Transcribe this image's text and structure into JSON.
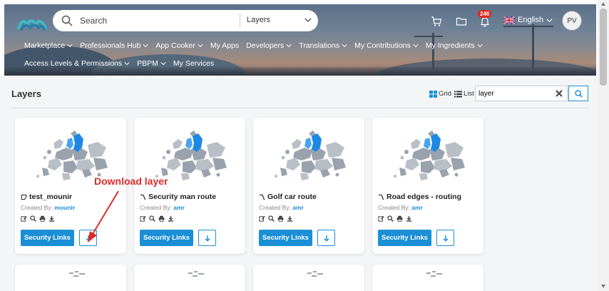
{
  "header": {
    "search_placeholder": "Search",
    "search_scope": "Layers",
    "notification_count": "246",
    "language": "English",
    "user_initials": "PV"
  },
  "nav": {
    "row1": [
      "Marketplace",
      "Professionals Hub",
      "App Cooker",
      "My Apps",
      "Developers",
      "Translations",
      "My Contributions",
      "My Ingredients"
    ],
    "row1_dropdown": [
      true,
      true,
      true,
      false,
      true,
      true,
      true,
      true
    ],
    "row2": [
      "Access Levels & Permissions",
      "PBPM",
      "My Services"
    ],
    "row2_dropdown": [
      true,
      true,
      false
    ]
  },
  "page": {
    "title": "Layers",
    "grid_label": "Grid",
    "list_label": "List",
    "filter_value": "layer"
  },
  "cards": [
    {
      "title": "test_mounir",
      "created_by_label": "Created By:",
      "author": "mounir",
      "links_label": "Security Links",
      "icon": "polygon-icon"
    },
    {
      "title": "Security man route",
      "created_by_label": "Created By:",
      "author": "amr",
      "links_label": "Security Links",
      "icon": "route-icon"
    },
    {
      "title": "Golf car route",
      "created_by_label": "Created By:",
      "author": "amr",
      "links_label": "Security Links",
      "icon": "route-icon"
    },
    {
      "title": "Road edges - routing",
      "created_by_label": "Created By:",
      "author": "amr",
      "links_label": "Security Links",
      "icon": "route-icon"
    }
  ],
  "annotation": {
    "text": "Download layer"
  },
  "colors": {
    "primary": "#1a8fd6",
    "badge": "#e0281e",
    "annotation": "#e02a2a",
    "map_highlight": "#1e88e5"
  }
}
